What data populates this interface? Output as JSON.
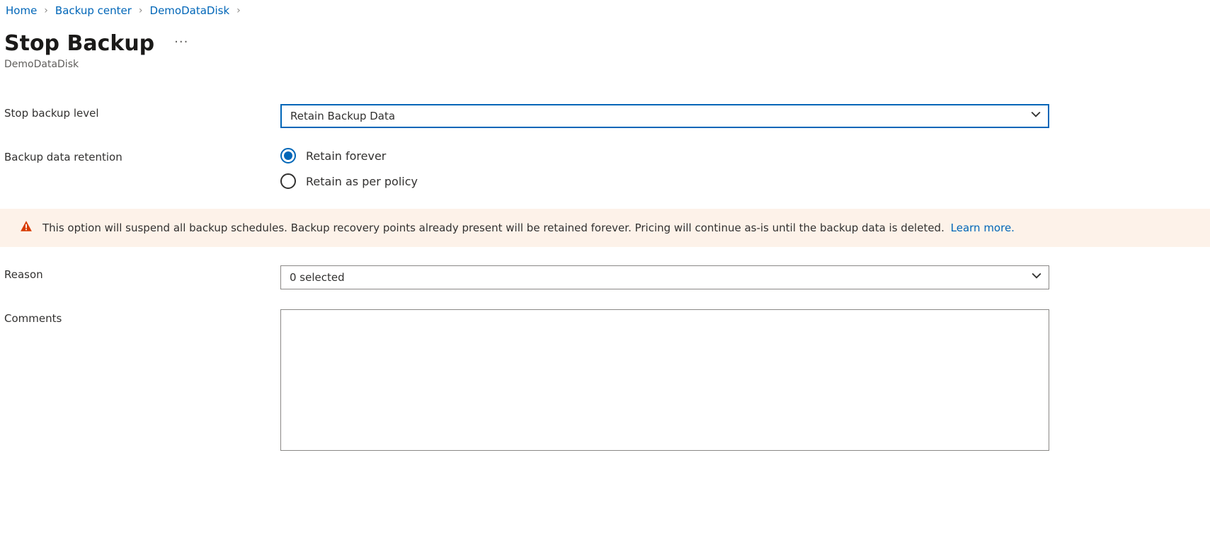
{
  "breadcrumb": {
    "home": "Home",
    "backup_center": "Backup center",
    "demo": "DemoDataDisk"
  },
  "header": {
    "title": "Stop Backup",
    "subtitle": "DemoDataDisk"
  },
  "form": {
    "stop_level": {
      "label": "Stop backup level",
      "value": "Retain Backup Data"
    },
    "retention": {
      "label": "Backup data retention",
      "options": {
        "forever": "Retain forever",
        "policy": "Retain as per policy"
      }
    },
    "reason": {
      "label": "Reason",
      "value": "0 selected"
    },
    "comments": {
      "label": "Comments",
      "value": ""
    }
  },
  "warning": {
    "text": "This option will suspend all backup schedules. Backup recovery points already present will be retained forever. Pricing will continue as-is until the backup data is deleted.",
    "link": "Learn more."
  }
}
